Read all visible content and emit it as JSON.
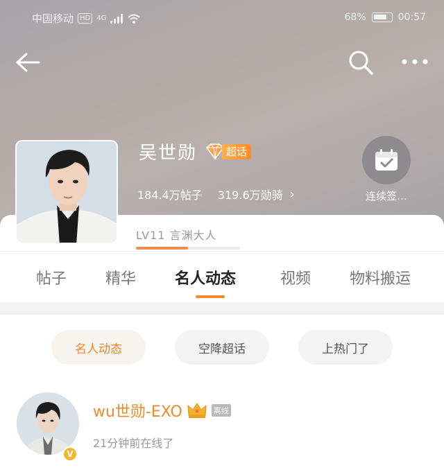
{
  "status_bar": {
    "carrier": "中国移动",
    "hd": "HD",
    "network": "4G",
    "battery": "68%",
    "time": "00:57"
  },
  "nav": {
    "back_icon": "arrow-left-icon",
    "search_icon": "search-icon",
    "more_icon": "more-dots-icon"
  },
  "profile": {
    "name": "吴世勋",
    "badge": "超话",
    "posts_stat": "184.4万帖子",
    "fans_stat": "319.6万勋骑",
    "level": "LV11 言渊大人",
    "level_progress": 0.5
  },
  "checkin": {
    "label": "连续签…"
  },
  "tabs": [
    {
      "label": "帖子",
      "active": false
    },
    {
      "label": "精华",
      "active": false
    },
    {
      "label": "名人动态",
      "active": true
    },
    {
      "label": "视频",
      "active": false
    },
    {
      "label": "物料搬运",
      "active": false
    }
  ],
  "filters": [
    {
      "label": "名人动态",
      "active": true
    },
    {
      "label": "空降超话",
      "active": false
    },
    {
      "label": "上热门了",
      "active": false
    }
  ],
  "post": {
    "username": "wu世勋-EXO",
    "status_tag": "离线",
    "last_online": "21分钟前在线了"
  },
  "colors": {
    "accent": "#f28a2f",
    "header_bg": "#b1abac",
    "username": "#ef8a2a"
  }
}
